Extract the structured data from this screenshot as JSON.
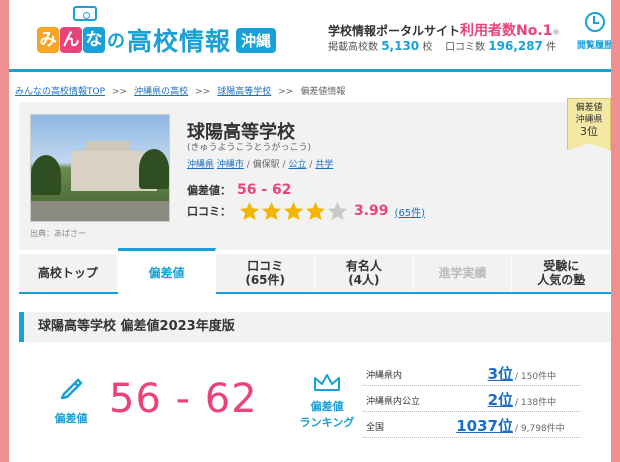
{
  "header": {
    "logo": {
      "mina_chars": [
        "み",
        "ん",
        "な"
      ],
      "mina_colors": [
        "#f5a623",
        "#e8437a",
        "#19a0d6"
      ],
      "no": "の",
      "main": "高校情報",
      "pref": "沖縄"
    },
    "tagline_prefix": "学校情報ポータルサイト",
    "tagline_highlight": "利用者数No.1",
    "tagline_note": "※",
    "stats": {
      "schools_label": "掲載高校数",
      "schools_value": "5,130",
      "schools_unit": "校",
      "reviews_label": "口コミ数",
      "reviews_value": "196,287",
      "reviews_unit": "件"
    },
    "history_label": "閲覧履歴"
  },
  "breadcrumb": {
    "items": [
      "みんなの高校情報TOP",
      "沖縄県の高校",
      "球陽高等学校",
      "偏差値情報"
    ],
    "separator": ">>"
  },
  "school": {
    "name": "球陽高等学校",
    "kana": "(きゅうようこうとうがっこう)",
    "tags": [
      "沖縄県",
      "沖縄市",
      "/ 偏保駅 /",
      "公立",
      "/",
      "共学"
    ],
    "photo_credit": "出典：あばさー",
    "deviation_label": "偏差値：",
    "deviation_value": "56 - 62",
    "review_label": "口コミ：",
    "rating": 3.99,
    "rating_text": "3.99",
    "review_count": "(65件)",
    "rank_badge": {
      "line1": "偏差値",
      "line2": "沖縄県",
      "line3": "3位"
    }
  },
  "tabs": [
    {
      "label": "高校トップ",
      "sub": ""
    },
    {
      "label": "偏差値",
      "sub": ""
    },
    {
      "label": "口コミ",
      "sub": "(65件)"
    },
    {
      "label": "有名人",
      "sub": "(4人)"
    },
    {
      "label": "進学実績",
      "sub": ""
    },
    {
      "label": "受験に",
      "sub": "人気の塾"
    }
  ],
  "section": {
    "title": "球陽高等学校 偏差値2023年度版",
    "dev_icon_label": "偏差値",
    "dev_value": "56 - 62",
    "rank_icon_label1": "偏差値",
    "rank_icon_label2": "ランキング",
    "rankings": [
      {
        "label": "沖縄県内",
        "rank": "3位",
        "total": "/ 150件中"
      },
      {
        "label": "沖縄県内公立",
        "rank": "2位",
        "total": "/ 138件中"
      },
      {
        "label": "全国",
        "rank": "1037位",
        "total": "/ 9,798件中"
      }
    ]
  },
  "colors": {
    "accent": "#19a0d6",
    "pink": "#e8437a",
    "link": "#1a6fc4",
    "star": "#f5b400",
    "frame": "#ef8f8f"
  }
}
